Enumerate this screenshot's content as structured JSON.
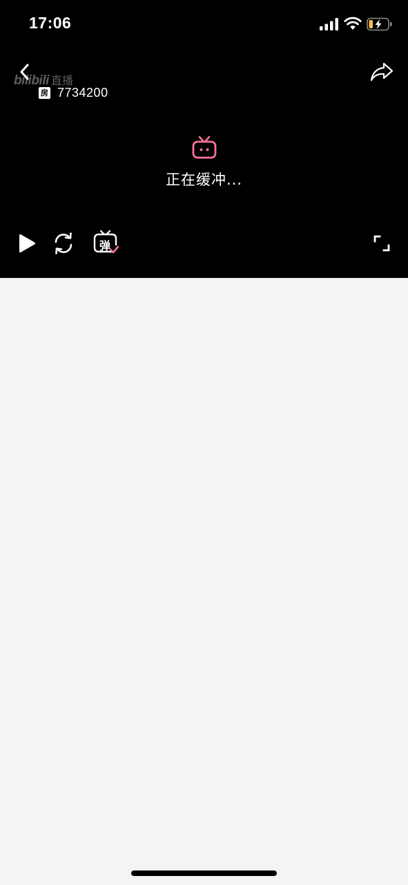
{
  "status_bar": {
    "time": "17:06"
  },
  "header": {
    "logo_brand": "bilibili",
    "logo_live": "直播",
    "room_badge": "房",
    "room_number": "7734200"
  },
  "player": {
    "buffering_text": "正在缓冲...",
    "danmaku_label": "弹"
  },
  "icons": {
    "back": "chevron-left-icon",
    "share": "share-arrow-icon",
    "tv": "bilibili-tv-icon",
    "play": "play-icon",
    "refresh": "refresh-icon",
    "danmaku": "danmaku-toggle-icon",
    "fullscreen": "fullscreen-icon"
  },
  "colors": {
    "accent_pink": "#fb7299",
    "player_bg": "#000000",
    "page_bg": "#f4f4f4",
    "battery_charging": "#f5c542"
  }
}
